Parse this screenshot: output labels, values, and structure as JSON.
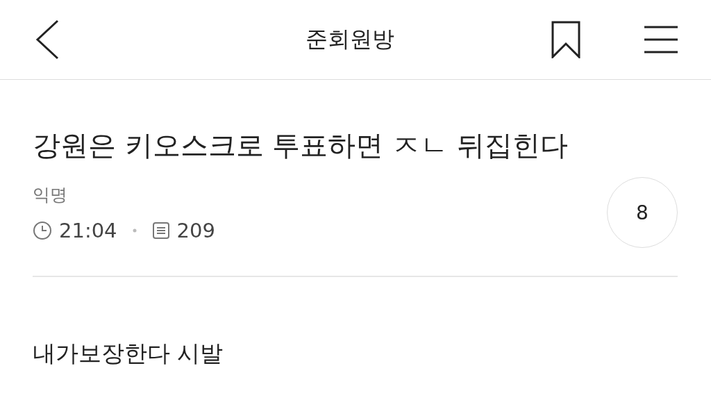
{
  "header": {
    "title": "준회원방"
  },
  "post": {
    "title": "강원은 키오스크로 투표하면 ㅈㄴ 뒤집힌다",
    "author": "익명",
    "time": "21:04",
    "views": "209",
    "comment_count": "8",
    "body": "내가보장한다 시발"
  }
}
